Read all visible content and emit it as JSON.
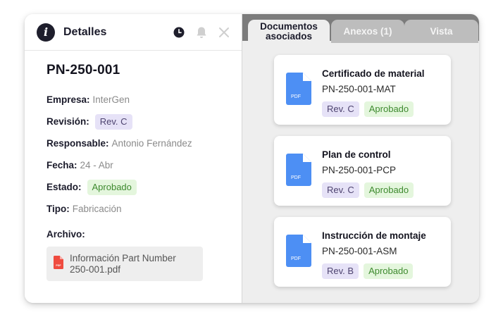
{
  "details_panel": {
    "title": "Detalles",
    "icons": [
      "info-icon",
      "clock-icon",
      "bell-icon",
      "close-icon"
    ],
    "document_number": "PN-250-001",
    "fields": {
      "empresa": {
        "label": "Empresa:",
        "value": "InterGen"
      },
      "revision": {
        "label": "Revisión:",
        "value": "Rev. C"
      },
      "responsable": {
        "label": "Responsable:",
        "value": "Antonio Fernández"
      },
      "fecha": {
        "label": "Fecha:",
        "value": "24 - Abr"
      },
      "estado": {
        "label": "Estado:",
        "value": "Aprobado"
      },
      "tipo": {
        "label": "Tipo:",
        "value": "Fabricación"
      }
    },
    "archivo": {
      "label": "Archivo:",
      "file_line1": "Información Part Number",
      "file_line2": "250-001.pdf",
      "file_icon_text": "PDF"
    }
  },
  "tabs": [
    {
      "line1": "Documentos",
      "line2": "asociados",
      "active": true
    },
    {
      "label": "Anexos (1)",
      "active": false
    },
    {
      "label": "Vista",
      "active": false
    }
  ],
  "documents": [
    {
      "title": "Certificado de material",
      "code": "PN-250-001-MAT",
      "revision": "Rev. C",
      "status": "Aprobado",
      "icon_text": "PDF"
    },
    {
      "title": "Plan de control",
      "code": "PN-250-001-PCP",
      "revision": "Rev. C",
      "status": "Aprobado",
      "icon_text": "PDF"
    },
    {
      "title": "Instrucción de montaje",
      "code": "PN-250-001-ASM",
      "revision": "Rev. B",
      "status": "Aprobado",
      "icon_text": "PDF"
    }
  ],
  "colors": {
    "revision_badge_bg": "#e6e2f7",
    "approved_badge_bg": "#e4f6dd",
    "approved_text": "#3e8a2f",
    "pdf_blue": "#4d8ff4",
    "pdf_red": "#ef4b3f",
    "tab_bar": "#7c7c7c"
  }
}
